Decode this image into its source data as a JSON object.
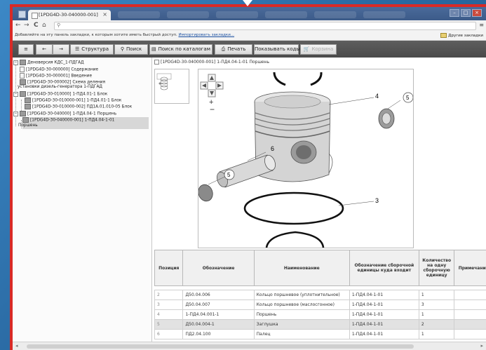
{
  "browser": {
    "tab_title": "[1PDG4D-30-040000-001]",
    "tab_close": "×",
    "nav_back": "←",
    "nav_forward": "→",
    "nav_reload": "C",
    "nav_home": "⌂",
    "url_value": "",
    "bookmarks_hint": "Добавляйте на эту панель закладки, к которым хотите иметь быстрый доступ.",
    "bookmarks_import": "Импортировать закладки...",
    "other_bookmarks": "Другие закладки"
  },
  "toolbar": {
    "menu": "≡",
    "back": "←",
    "forward": "→",
    "structure": "Структура",
    "search": "Поиск",
    "catalog_search": "Поиск по каталогам",
    "print": "Печать",
    "show_codes": "Показывать коды",
    "cart": "Корзина"
  },
  "tree": {
    "root": "Деноверсия КДС_1-ПДГАД",
    "n1": "[1PDG4D-30-000000] Содержание",
    "n2": "[1PDG4D-30-000001] Введение",
    "n3a": "[1PDG4D-30-000002] Схема деления",
    "n3b": "установки дизель-генератора 1-ПДГАД",
    "n4": "[1PDG4D-30-010000] 1-ПД4.01-1 Блок",
    "n5": "[1PDG4D-30-010000-001] 1-ПД4.01-1 Блок",
    "n6": "[1PDG4D-30-010000-002] ПД1А.01.010-05 Блок",
    "n7": "[1PDG4D-30-040000] 1-ПД4.04-1 Поршень",
    "n8a": "[1PDG4D-30-040000-001] 1-ПД4.04-1-01",
    "n8b": "Поршень"
  },
  "breadcrumb": "[1PDG4D-30-040000-001] 1-ПД4.04-1-01 Поршень",
  "drawing": {
    "callouts": [
      "4",
      "5",
      "6",
      "5",
      "3"
    ]
  },
  "table": {
    "headers": [
      "Позиция",
      "Обозначение",
      "Наименование",
      "Обозначение сборочной единицы куда входит",
      "Количество на одну сборочную единицу",
      "Примечание"
    ],
    "rows": [
      {
        "pos": "2",
        "code": "Д50.04.006",
        "name": "Кольцо поршневое (уплотнительное)",
        "parent": "1-ПД4.04-1-01",
        "qty": "1",
        "note": ""
      },
      {
        "pos": "3",
        "code": "Д50.04.007",
        "name": "Кольцо поршневое (маслосгонное)",
        "parent": "1-ПД4.04-1-01",
        "qty": "3",
        "note": ""
      },
      {
        "pos": "4",
        "code": "1-ПД4.04.001-1",
        "name": "Поршень",
        "parent": "1-ПД4.04-1-01",
        "qty": "1",
        "note": ""
      },
      {
        "pos": "5",
        "code": "Д50.04.004-1",
        "name": "Заглушка",
        "parent": "1-ПД4.04-1-01",
        "qty": "2",
        "note": ""
      },
      {
        "pos": "6",
        "code": "ПД2.04.100",
        "name": "Палец",
        "parent": "1-ПД4.04-1-01",
        "qty": "1",
        "note": ""
      }
    ]
  },
  "scrollbar": {
    "left": "◂",
    "right": "▸"
  },
  "colors": {
    "frame": "#d92a26",
    "toolbar": "#4f4f4f",
    "desktop": "#2d6fa8"
  }
}
